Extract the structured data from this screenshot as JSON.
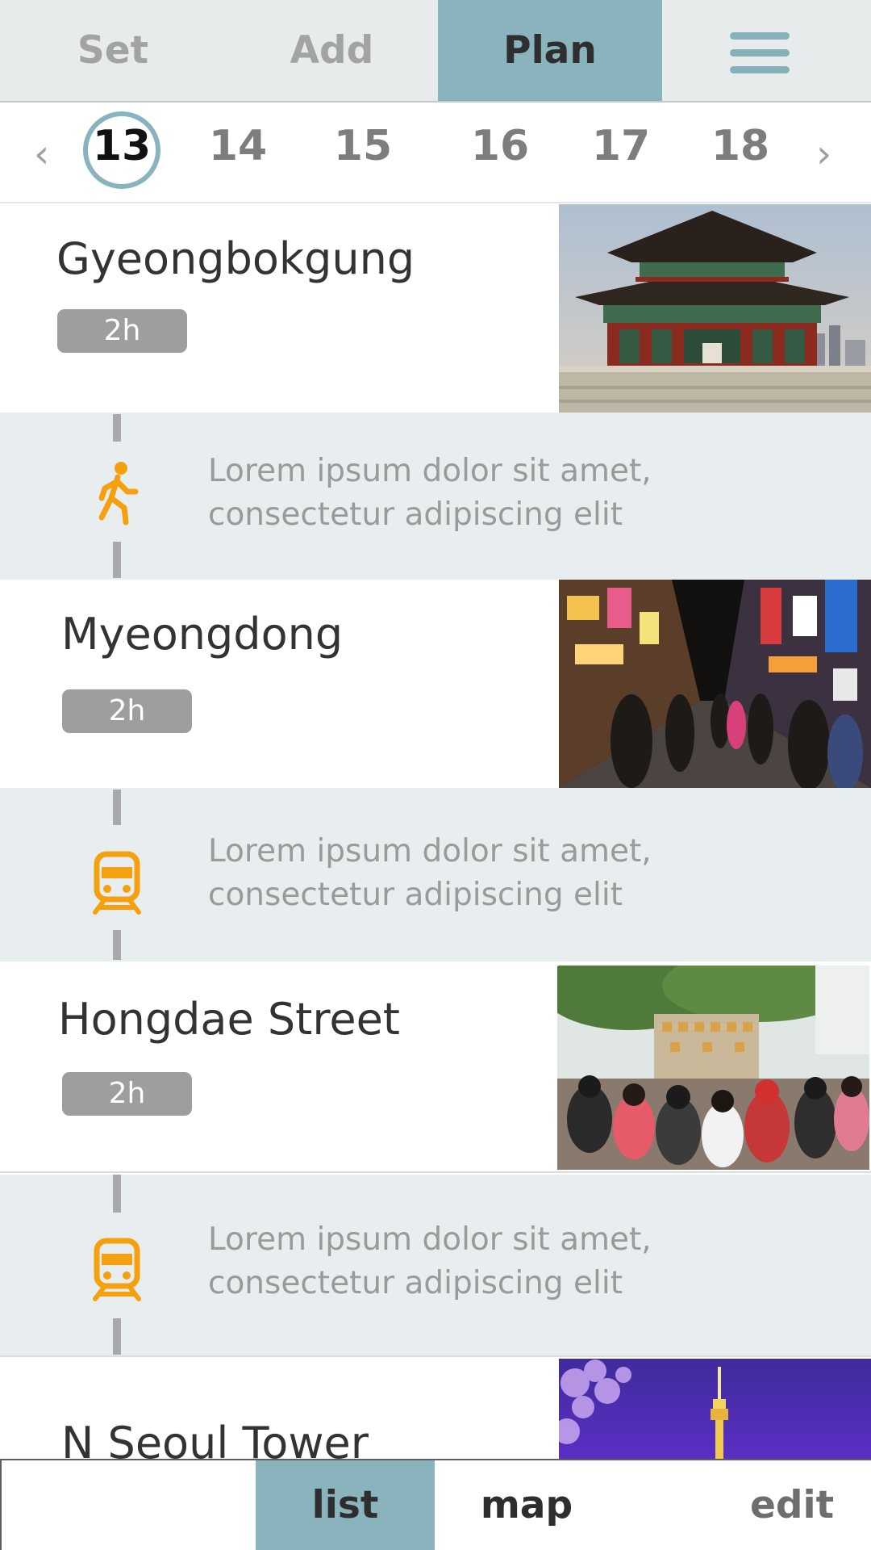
{
  "top_tabs": [
    {
      "label": "Set"
    },
    {
      "label": "Add"
    },
    {
      "label": "Plan",
      "active": true
    }
  ],
  "menu_icon": "hamburger-menu-icon",
  "date_strip": {
    "prev_icon": "chevron-left-icon",
    "next_icon": "chevron-right-icon",
    "days": [
      "13",
      "14",
      "15",
      "16",
      "17",
      "18"
    ],
    "selected": "13"
  },
  "itinerary": [
    {
      "name": "Gyeongbokgung",
      "duration": "2h",
      "photo": "gyeongbokgung-palace-photo"
    },
    {
      "transit": {
        "icon": "walking-person-icon",
        "line1": "Lorem ipsum dolor sit amet,",
        "line2": "consectetur adipiscing elit"
      }
    },
    {
      "name": "Myeongdong",
      "duration": "2h",
      "photo": "myeongdong-street-photo"
    },
    {
      "transit": {
        "icon": "train-icon",
        "line1": "Lorem ipsum dolor sit amet,",
        "line2": "consectetur adipiscing elit"
      }
    },
    {
      "name": "Hongdae Street",
      "duration": "2h",
      "photo": "hongdae-street-photo"
    },
    {
      "transit": {
        "icon": "train-icon",
        "line1": "Lorem ipsum dolor sit amet,",
        "line2": "consectetur adipiscing elit"
      }
    },
    {
      "name": "N Seoul Tower",
      "photo": "n-seoul-tower-photo"
    }
  ],
  "bottom_tabs": [
    {
      "label": "list",
      "active": true
    },
    {
      "label": "map"
    },
    {
      "label": "edit"
    }
  ],
  "colors": {
    "accent": "#8ab4bd",
    "transit_icon": "#f5a00f",
    "badge": "#9e9e9e",
    "transit_bg": "#e8eef0"
  }
}
